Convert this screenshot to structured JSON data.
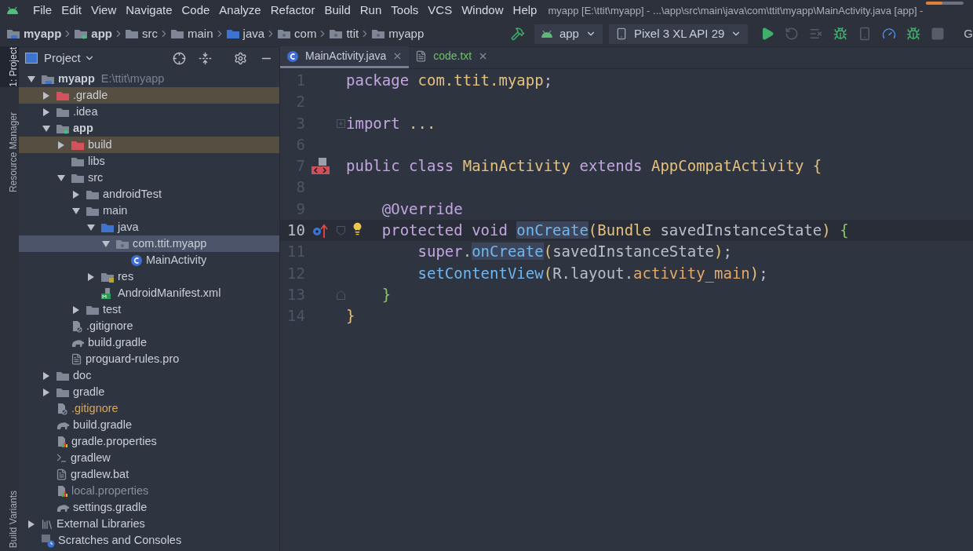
{
  "menu_bar": {
    "items": [
      "File",
      "Edit",
      "View",
      "Navigate",
      "Code",
      "Analyze",
      "Refactor",
      "Build",
      "Run",
      "Tools",
      "VCS",
      "Window",
      "Help"
    ],
    "title": "myapp [E:\\ttit\\myapp] - ...\\app\\src\\main\\java\\com\\ttit\\myapp\\MainActivity.java [app] -",
    "progress": {
      "level": 0.43
    }
  },
  "breadcrumbs": [
    {
      "label": "myapp",
      "kind": "project"
    },
    {
      "label": "app",
      "kind": "module"
    },
    {
      "label": "src",
      "kind": "folder"
    },
    {
      "label": "main",
      "kind": "folder"
    },
    {
      "label": "java",
      "kind": "source"
    },
    {
      "label": "com",
      "kind": "package"
    },
    {
      "label": "ttit",
      "kind": "package"
    },
    {
      "label": "myapp",
      "kind": "package"
    }
  ],
  "toolbar": {
    "config": "app",
    "device": "Pixel 3 XL API 29",
    "buttons": [
      {
        "kind": "run",
        "disabled": false
      },
      {
        "kind": "rerun",
        "disabled": true
      },
      {
        "kind": "log",
        "disabled": true
      },
      {
        "kind": "debug",
        "disabled": false
      },
      {
        "kind": "attach",
        "disabled": true
      },
      {
        "kind": "profile",
        "disabled": false
      },
      {
        "kind": "attach-debugger",
        "disabled": false
      },
      {
        "kind": "stop",
        "disabled": true
      }
    ],
    "edge_text": "G"
  },
  "side_stripe": [
    {
      "label": "1: Project",
      "selected": true
    },
    {
      "label": "Resource Manager",
      "selected": false
    },
    {
      "label": "Build Variants",
      "selected": false
    }
  ],
  "project_panel": {
    "title": "Project",
    "tree": [
      {
        "label": "myapp",
        "path": "E:\\ttit\\myapp",
        "kind": "project",
        "expanded": true,
        "selected": false,
        "children": [
          {
            "label": ".gradle",
            "kind": "folder",
            "expanded": false,
            "selected": false,
            "excluded": true
          },
          {
            "label": ".idea",
            "kind": "folder",
            "expanded": false,
            "selected": false
          },
          {
            "label": "app",
            "kind": "module",
            "expanded": true,
            "selected": false,
            "children": [
              {
                "label": "build",
                "kind": "folder",
                "expanded": false,
                "selected": false,
                "excluded": true
              },
              {
                "label": "libs",
                "kind": "folder",
                "selected": false
              },
              {
                "label": "src",
                "kind": "folder",
                "expanded": true,
                "selected": false,
                "children": [
                  {
                    "label": "androidTest",
                    "kind": "folder",
                    "expanded": false,
                    "selected": false
                  },
                  {
                    "label": "main",
                    "kind": "folder",
                    "expanded": true,
                    "selected": false,
                    "children": [
                      {
                        "label": "java",
                        "kind": "source",
                        "expanded": true,
                        "selected": false,
                        "children": [
                          {
                            "label": "com.ttit.myapp",
                            "kind": "package",
                            "expanded": true,
                            "selected": true,
                            "children": [
                              {
                                "label": "MainActivity",
                                "kind": "class",
                                "selected": false
                              }
                            ]
                          }
                        ]
                      },
                      {
                        "label": "res",
                        "kind": "resources",
                        "expanded": false,
                        "selected": false
                      },
                      {
                        "label": "AndroidManifest.xml",
                        "kind": "manifest",
                        "selected": false
                      }
                    ]
                  },
                  {
                    "label": "test",
                    "kind": "folder",
                    "expanded": false,
                    "selected": false
                  }
                ]
              },
              {
                "label": ".gitignore",
                "kind": "ignore",
                "selected": false
              },
              {
                "label": "build.gradle",
                "kind": "gradle",
                "selected": false
              },
              {
                "label": "proguard-rules.pro",
                "kind": "text",
                "selected": false
              }
            ]
          },
          {
            "label": "doc",
            "kind": "folder",
            "expanded": false,
            "selected": false
          },
          {
            "label": "gradle",
            "kind": "folder",
            "expanded": false,
            "selected": false
          },
          {
            "label": ".gitignore",
            "kind": "ignore",
            "unversioned": true,
            "selected": false
          },
          {
            "label": "build.gradle",
            "kind": "gradle",
            "selected": false
          },
          {
            "label": "gradle.properties",
            "kind": "properties",
            "selected": false
          },
          {
            "label": "gradlew",
            "kind": "script",
            "selected": false
          },
          {
            "label": "gradlew.bat",
            "kind": "text",
            "selected": false
          },
          {
            "label": "local.properties",
            "kind": "properties",
            "ignored": true,
            "selected": false
          },
          {
            "label": "settings.gradle",
            "kind": "gradle",
            "selected": false
          }
        ]
      },
      {
        "label": "External Libraries",
        "kind": "libraries",
        "expanded": false,
        "selected": false
      },
      {
        "label": "Scratches and Consoles",
        "kind": "scratches",
        "selected": false
      }
    ]
  },
  "editor_tabs": [
    {
      "label": "MainActivity.java",
      "kind": "class",
      "added": false,
      "selected": true
    },
    {
      "label": "code.txt",
      "kind": "text",
      "added": true,
      "selected": false
    }
  ],
  "code_lines": [
    {
      "number": "1",
      "current": false,
      "tokens": [
        {
          "kind": "keyword",
          "text": "package "
        },
        {
          "kind": "name",
          "text": "com.ttit.myapp"
        },
        {
          "kind": "plain",
          "text": ";"
        }
      ]
    },
    {
      "number": "2",
      "current": false
    },
    {
      "number": "3",
      "current": false,
      "gutter": [
        {
          "kind": "fold-collapsed"
        }
      ],
      "tokens": [
        {
          "kind": "keyword",
          "text": "import "
        },
        {
          "kind": "name",
          "text": "..."
        }
      ]
    },
    {
      "number": "6",
      "current": false
    },
    {
      "number": "7",
      "current": false,
      "gutter": [
        {
          "kind": "layout"
        }
      ],
      "tokens": [
        {
          "kind": "keyword",
          "text": "public class "
        },
        {
          "kind": "name",
          "text": "MainActivity "
        },
        {
          "kind": "keyword",
          "text": "extends "
        },
        {
          "kind": "name",
          "text": "AppCompatActivity "
        },
        {
          "kind": "brace",
          "text": "{"
        }
      ]
    },
    {
      "number": "8",
      "current": false
    },
    {
      "number": "9",
      "current": false,
      "tokens": [
        {
          "kind": "annotation",
          "text": "    @Override"
        }
      ]
    },
    {
      "number": "10",
      "current": true,
      "gutter": [
        {
          "kind": "override"
        },
        {
          "kind": "fold-start"
        },
        {
          "kind": "intention"
        }
      ],
      "tokens": [
        {
          "kind": "keyword",
          "text": "    protected void "
        },
        {
          "kind": "method",
          "text": "onCreate",
          "highlight": true
        },
        {
          "kind": "paren",
          "text": "("
        },
        {
          "kind": "name",
          "text": "Bundle "
        },
        {
          "kind": "plain",
          "text": "savedInstanceState"
        },
        {
          "kind": "paren",
          "text": ") "
        },
        {
          "kind": "block",
          "text": "{"
        }
      ]
    },
    {
      "number": "11",
      "current": false,
      "tokens": [
        {
          "kind": "keyword",
          "text": "        super"
        },
        {
          "kind": "plain",
          "text": "."
        },
        {
          "kind": "method",
          "text": "onCreate",
          "highlight": true
        },
        {
          "kind": "paren",
          "text": "("
        },
        {
          "kind": "plain",
          "text": "savedInstanceState"
        },
        {
          "kind": "paren",
          "text": ")"
        },
        {
          "kind": "plain",
          "text": ";"
        }
      ]
    },
    {
      "number": "12",
      "current": false,
      "tokens": [
        {
          "kind": "method",
          "text": "        setContentView"
        },
        {
          "kind": "paren",
          "text": "("
        },
        {
          "kind": "plain",
          "text": "R.layout."
        },
        {
          "kind": "field",
          "text": "activity_main"
        },
        {
          "kind": "paren",
          "text": ")"
        },
        {
          "kind": "plain",
          "text": ";"
        }
      ]
    },
    {
      "number": "13",
      "current": false,
      "gutter": [
        {
          "kind": "fold-end"
        }
      ],
      "tokens": [
        {
          "kind": "block",
          "text": "    }"
        }
      ]
    },
    {
      "number": "14",
      "current": false,
      "tokens": [
        {
          "kind": "brace",
          "text": "}"
        }
      ]
    }
  ]
}
